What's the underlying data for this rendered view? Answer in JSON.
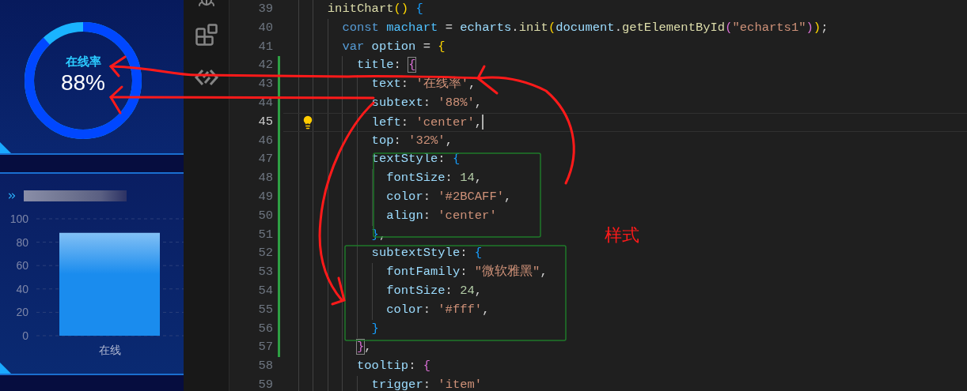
{
  "dashboard": {
    "gauge": {
      "title": "在线率",
      "value": "88%"
    },
    "bar_panel": {
      "chart_data": {
        "type": "bar",
        "categories": [
          "在线"
        ],
        "values": [
          88
        ],
        "ylim": [
          0,
          100
        ],
        "yticks": [
          0,
          20,
          40,
          60,
          80,
          100
        ],
        "grid": true
      }
    }
  },
  "editor": {
    "lines": [
      {
        "number": "39",
        "current": false,
        "modified": false,
        "tokens": [
          {
            "kind": "fn",
            "text": "initChart"
          },
          {
            "kind": "b1",
            "text": "()"
          },
          {
            "kind": "b3",
            "text": " {"
          }
        ]
      },
      {
        "number": "40",
        "current": false,
        "modified": false,
        "tokens": [
          {
            "kind": "kw",
            "text": "const "
          },
          {
            "kind": "const",
            "text": "machart"
          },
          {
            "kind": "p",
            "text": " = "
          },
          {
            "kind": "var",
            "text": "echarts"
          },
          {
            "kind": "p",
            "text": "."
          },
          {
            "kind": "fn",
            "text": "init"
          },
          {
            "kind": "b1",
            "text": "("
          },
          {
            "kind": "var",
            "text": "document"
          },
          {
            "kind": "p",
            "text": "."
          },
          {
            "kind": "fn",
            "text": "getElementById"
          },
          {
            "kind": "b2",
            "text": "("
          },
          {
            "kind": "str",
            "text": "\"echarts1\""
          },
          {
            "kind": "b2",
            "text": ")"
          },
          {
            "kind": "b1",
            "text": ")"
          },
          {
            "kind": "p",
            "text": ";"
          }
        ]
      },
      {
        "number": "41",
        "current": false,
        "modified": false,
        "tokens": [
          {
            "kind": "kw",
            "text": "var "
          },
          {
            "kind": "var",
            "text": "option"
          },
          {
            "kind": "p",
            "text": " = "
          },
          {
            "kind": "b1",
            "text": "{"
          }
        ]
      },
      {
        "number": "42",
        "current": false,
        "modified": true,
        "tokens": [
          {
            "kind": "var",
            "text": "title"
          },
          {
            "kind": "p",
            "text": ": "
          },
          {
            "kind": "b2box",
            "text": "{"
          }
        ]
      },
      {
        "number": "43",
        "current": false,
        "modified": true,
        "tokens": [
          {
            "kind": "var",
            "text": "text"
          },
          {
            "kind": "p",
            "text": ": "
          },
          {
            "kind": "str",
            "text": "'在线率'"
          },
          {
            "kind": "p",
            "text": ","
          }
        ]
      },
      {
        "number": "44",
        "current": false,
        "modified": true,
        "tokens": [
          {
            "kind": "var",
            "text": "subtext"
          },
          {
            "kind": "p",
            "text": ": "
          },
          {
            "kind": "str",
            "text": "'88%'"
          },
          {
            "kind": "p",
            "text": ","
          }
        ]
      },
      {
        "number": "45",
        "current": true,
        "modified": true,
        "tokens": [
          {
            "kind": "var",
            "text": "left"
          },
          {
            "kind": "p",
            "text": ": "
          },
          {
            "kind": "str",
            "text": "'center'"
          },
          {
            "kind": "p",
            "text": ","
          }
        ]
      },
      {
        "number": "46",
        "current": false,
        "modified": true,
        "tokens": [
          {
            "kind": "var",
            "text": "top"
          },
          {
            "kind": "p",
            "text": ": "
          },
          {
            "kind": "str",
            "text": "'32%'"
          },
          {
            "kind": "p",
            "text": ","
          }
        ]
      },
      {
        "number": "47",
        "current": false,
        "modified": true,
        "tokens": [
          {
            "kind": "var",
            "text": "textStyle"
          },
          {
            "kind": "p",
            "text": ": "
          },
          {
            "kind": "b3",
            "text": "{"
          }
        ]
      },
      {
        "number": "48",
        "current": false,
        "modified": true,
        "tokens": [
          {
            "kind": "var",
            "text": "fontSize"
          },
          {
            "kind": "p",
            "text": ": "
          },
          {
            "kind": "num",
            "text": "14"
          },
          {
            "kind": "p",
            "text": ","
          }
        ]
      },
      {
        "number": "49",
        "current": false,
        "modified": true,
        "tokens": [
          {
            "kind": "var",
            "text": "color"
          },
          {
            "kind": "p",
            "text": ": "
          },
          {
            "kind": "str",
            "text": "'#2BCAFF'"
          },
          {
            "kind": "p",
            "text": ","
          }
        ]
      },
      {
        "number": "50",
        "current": false,
        "modified": true,
        "tokens": [
          {
            "kind": "var",
            "text": "align"
          },
          {
            "kind": "p",
            "text": ": "
          },
          {
            "kind": "str",
            "text": "'center'"
          }
        ]
      },
      {
        "number": "51",
        "current": false,
        "modified": true,
        "tokens": [
          {
            "kind": "b3",
            "text": "}"
          },
          {
            "kind": "p",
            "text": ","
          }
        ]
      },
      {
        "number": "52",
        "current": false,
        "modified": true,
        "tokens": [
          {
            "kind": "var",
            "text": "subtextStyle"
          },
          {
            "kind": "p",
            "text": ": "
          },
          {
            "kind": "b3",
            "text": "{"
          }
        ]
      },
      {
        "number": "53",
        "current": false,
        "modified": true,
        "tokens": [
          {
            "kind": "var",
            "text": "fontFamily"
          },
          {
            "kind": "p",
            "text": ": "
          },
          {
            "kind": "str",
            "text": "\"微软雅黑\""
          },
          {
            "kind": "p",
            "text": ","
          }
        ]
      },
      {
        "number": "54",
        "current": false,
        "modified": true,
        "tokens": [
          {
            "kind": "var",
            "text": "fontSize"
          },
          {
            "kind": "p",
            "text": ": "
          },
          {
            "kind": "num",
            "text": "24"
          },
          {
            "kind": "p",
            "text": ","
          }
        ]
      },
      {
        "number": "55",
        "current": false,
        "modified": true,
        "tokens": [
          {
            "kind": "var",
            "text": "color"
          },
          {
            "kind": "p",
            "text": ": "
          },
          {
            "kind": "str",
            "text": "'#fff'"
          },
          {
            "kind": "p",
            "text": ","
          }
        ]
      },
      {
        "number": "56",
        "current": false,
        "modified": true,
        "tokens": [
          {
            "kind": "b3",
            "text": "}"
          }
        ]
      },
      {
        "number": "57",
        "current": false,
        "modified": true,
        "tokens": [
          {
            "kind": "b2box",
            "text": "}"
          },
          {
            "kind": "p",
            "text": ","
          }
        ]
      },
      {
        "number": "58",
        "current": false,
        "modified": false,
        "tokens": [
          {
            "kind": "var",
            "text": "tooltip"
          },
          {
            "kind": "p",
            "text": ": "
          },
          {
            "kind": "b2",
            "text": "{"
          }
        ]
      },
      {
        "number": "59",
        "current": false,
        "modified": false,
        "tokens": [
          {
            "kind": "var",
            "text": "trigger"
          },
          {
            "kind": "p",
            "text": ": "
          },
          {
            "kind": "str",
            "text": "'item'"
          }
        ]
      }
    ]
  },
  "annotation": {
    "label": "样式"
  }
}
